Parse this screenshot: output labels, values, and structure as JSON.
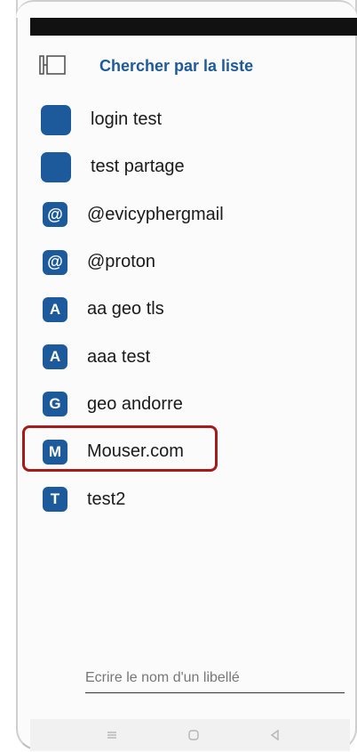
{
  "header": {
    "title": "Chercher par la liste",
    "menu_icon": "sidebar-toggle-icon"
  },
  "accent_color": "#1d5a9c",
  "highlight_color": "#a51b1b",
  "items": [
    {
      "badge": "",
      "label": "login test"
    },
    {
      "badge": "",
      "label": "test partage"
    },
    {
      "badge": "@",
      "label": "@evicyphergmail"
    },
    {
      "badge": "@",
      "label": "@proton"
    },
    {
      "badge": "A",
      "label": "aa geo tls"
    },
    {
      "badge": "A",
      "label": "aaa test"
    },
    {
      "badge": "G",
      "label": "geo andorre"
    },
    {
      "badge": "M",
      "label": "Mouser.com"
    },
    {
      "badge": "T",
      "label": "test2"
    }
  ],
  "input": {
    "placeholder": "Ecrire le nom d'un libellé",
    "value": ""
  },
  "navbar": {
    "icons": [
      "menu-lines-icon",
      "home-square-icon",
      "back-triangle-icon"
    ]
  }
}
